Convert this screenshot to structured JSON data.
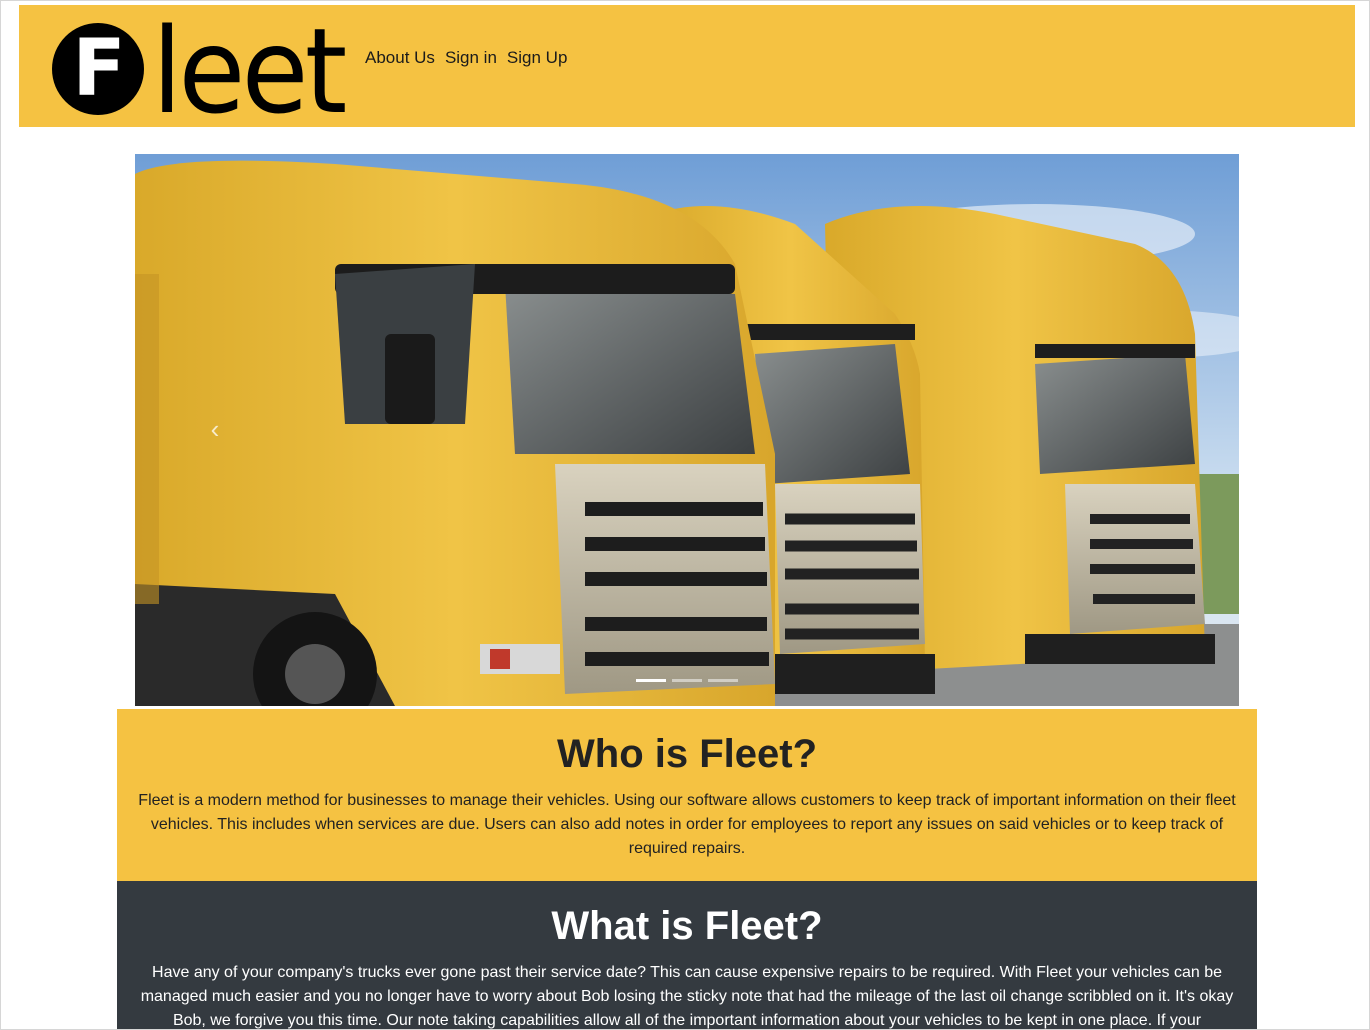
{
  "header": {
    "logo_letter": "F",
    "logo_word": "leet",
    "nav": [
      {
        "label": "About Us"
      },
      {
        "label": "Sign in"
      },
      {
        "label": "Sign Up"
      }
    ],
    "colors": {
      "brand": "#f5c242",
      "logo": "#000000"
    }
  },
  "carousel": {
    "prev_icon": "chevron-left-icon",
    "prev_glyph": "‹",
    "slide_count": 3,
    "active_slide": 1,
    "image_subject": "three yellow semi trucks"
  },
  "who": {
    "title": "Who is Fleet?",
    "text": "Fleet is a modern method for businesses to manage their vehicles. Using our software allows customers to keep track of important information on their fleet vehicles. This includes when services are due. Users can also add notes in order for employees to report any issues on said vehicles or to keep track of required repairs.",
    "color": "#f5c242"
  },
  "what": {
    "title": "What is Fleet?",
    "text": "Have any of your company's trucks ever gone past their service date? This can cause expensive repairs to be required. With Fleet your vehicles can be managed much easier and you no longer have to worry about Bob losing the sticky note that had the mileage of the last oil change scribbled on it. It's okay Bob, we forgive you this time. Our note taking capabilities allow all of the important information about your vehicles to be kept in one place. If your",
    "color": "#343a40"
  }
}
